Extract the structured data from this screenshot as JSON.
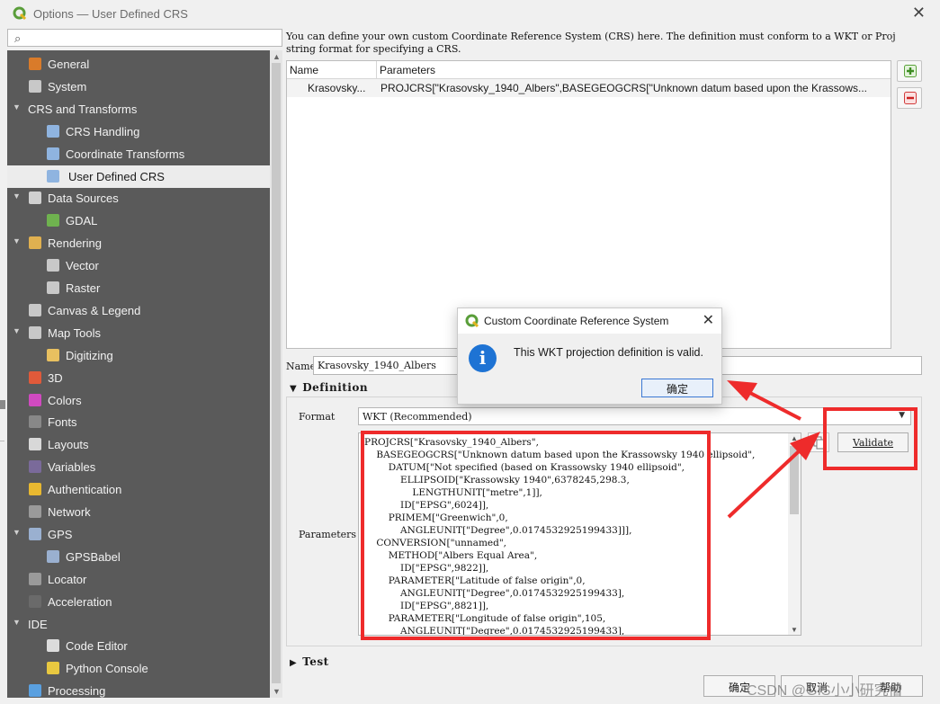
{
  "window": {
    "title": "Options — User Defined CRS",
    "close_glyph": "✕"
  },
  "search": {
    "placeholder": "",
    "icon": "search-icon"
  },
  "sidebar": {
    "items": [
      {
        "label": "General",
        "level": 0,
        "expander": "",
        "icon": "wrench-icon",
        "color": "#d97b2a"
      },
      {
        "label": "System",
        "level": 0,
        "expander": "",
        "icon": "gear-icon",
        "color": "#c8c8c8"
      },
      {
        "label": "CRS and Transforms",
        "level": 0,
        "expander": "▼",
        "icon": "",
        "color": ""
      },
      {
        "label": "CRS Handling",
        "level": 1,
        "expander": "",
        "icon": "globe-icon",
        "color": "#8fb4e0"
      },
      {
        "label": "Coordinate Transforms",
        "level": 1,
        "expander": "",
        "icon": "globe-icon",
        "color": "#8fb4e0"
      },
      {
        "label": "User Defined CRS",
        "level": 1,
        "expander": "",
        "icon": "user-globe-icon",
        "color": "#8fb4e0",
        "selected": true
      },
      {
        "label": "Data Sources",
        "level": 0,
        "expander": "▼",
        "icon": "table-icon",
        "color": "#d0d0d0"
      },
      {
        "label": "GDAL",
        "level": 1,
        "expander": "",
        "icon": "gdal-globe-icon",
        "color": "#6fb24f"
      },
      {
        "label": "Rendering",
        "level": 0,
        "expander": "▼",
        "icon": "brush-icon",
        "color": "#e0b050"
      },
      {
        "label": "Vector",
        "level": 1,
        "expander": "",
        "icon": "vector-icon",
        "color": "#c8c8c8"
      },
      {
        "label": "Raster",
        "level": 1,
        "expander": "",
        "icon": "raster-icon",
        "color": "#c8c8c8"
      },
      {
        "label": "Canvas & Legend",
        "level": 0,
        "expander": "",
        "icon": "canvas-icon",
        "color": "#c8c8c8"
      },
      {
        "label": "Map Tools",
        "level": 0,
        "expander": "▼",
        "icon": "map-tools-icon",
        "color": "#c8c8c8"
      },
      {
        "label": "Digitizing",
        "level": 1,
        "expander": "",
        "icon": "digitizing-icon",
        "color": "#e8c060"
      },
      {
        "label": "3D",
        "level": 0,
        "expander": "",
        "icon": "cube-icon",
        "color": "#e05a3a"
      },
      {
        "label": "Colors",
        "level": 0,
        "expander": "",
        "icon": "palette-icon",
        "color": "#d04ac0"
      },
      {
        "label": "Fonts",
        "level": 0,
        "expander": "",
        "icon": "font-icon",
        "color": "#888888"
      },
      {
        "label": "Layouts",
        "level": 0,
        "expander": "",
        "icon": "layout-icon",
        "color": "#d8d8d8"
      },
      {
        "label": "Variables",
        "level": 0,
        "expander": "",
        "icon": "variables-icon",
        "color": "#7a6a9a"
      },
      {
        "label": "Authentication",
        "level": 0,
        "expander": "",
        "icon": "lock-icon",
        "color": "#e8b830"
      },
      {
        "label": "Network",
        "level": 0,
        "expander": "",
        "icon": "network-icon",
        "color": "#9a9a9a"
      },
      {
        "label": "GPS",
        "level": 0,
        "expander": "▼",
        "icon": "gps-icon",
        "color": "#9ab0d0"
      },
      {
        "label": "GPSBabel",
        "level": 1,
        "expander": "",
        "icon": "gpsbabel-icon",
        "color": "#9ab0d0"
      },
      {
        "label": "Locator",
        "level": 0,
        "expander": "",
        "icon": "locator-search-icon",
        "color": "#9a9a9a"
      },
      {
        "label": "Acceleration",
        "level": 0,
        "expander": "",
        "icon": "acceleration-icon",
        "color": "#6a6a6a"
      },
      {
        "label": "IDE",
        "level": 0,
        "expander": "▼",
        "icon": "",
        "color": ""
      },
      {
        "label": "Code Editor",
        "level": 1,
        "expander": "",
        "icon": "code-editor-icon",
        "color": "#dcdcdc"
      },
      {
        "label": "Python Console",
        "level": 1,
        "expander": "",
        "icon": "python-icon",
        "color": "#e8c840"
      },
      {
        "label": "Processing",
        "level": 0,
        "expander": "",
        "icon": "processing-gear-icon",
        "color": "#5aa0e0"
      }
    ]
  },
  "description": "You can define your own custom Coordinate Reference System (CRS) here. The definition must conform to a WKT or Proj string format for specifying a CRS.",
  "crs_table": {
    "columns": [
      "Name",
      "Parameters"
    ],
    "rows": [
      {
        "name": "Krasovsky...",
        "parameters": "PROJCRS[\"Krasovsky_1940_Albers\",BASEGEOGCRS[\"Unknown datum based upon the Krassows..."
      }
    ]
  },
  "buttons": {
    "add": "add-crs-icon",
    "remove": "remove-crs-icon",
    "validate": "Validate",
    "ok": "确定",
    "cancel": "取消",
    "help": "帮助"
  },
  "name_field": {
    "label": "Name",
    "value": "Krasovsky_1940_Albers"
  },
  "definition": {
    "header": "Definition",
    "format_label": "Format",
    "format_value": "WKT (Recommended)",
    "params_label": "Parameters",
    "wkt_text": "PROJCRS[\"Krasovsky_1940_Albers\",\n    BASEGEOGCRS[\"Unknown datum based upon the Krassowsky 1940 ellipsoid\",\n        DATUM[\"Not specified (based on Krassowsky 1940 ellipsoid\",\n            ELLIPSOID[\"Krassowsky 1940\",6378245,298.3,\n                LENGTHUNIT[\"metre\",1]],\n            ID[\"EPSG\",6024]],\n        PRIMEM[\"Greenwich\",0,\n            ANGLEUNIT[\"Degree\",0.0174532925199433]]],\n    CONVERSION[\"unnamed\",\n        METHOD[\"Albers Equal Area\",\n            ID[\"EPSG\",9822]],\n        PARAMETER[\"Latitude of false origin\",0,\n            ANGLEUNIT[\"Degree\",0.0174532925199433],\n            ID[\"EPSG\",8821]],\n        PARAMETER[\"Longitude of false origin\",105,\n            ANGLEUNIT[\"Degree\",0.0174532925199433],"
  },
  "test_header": "Test",
  "dialog": {
    "title": "Custom Coordinate Reference System",
    "message": "This WKT projection definition is valid.",
    "ok": "确定",
    "close_glyph": "✕",
    "info_glyph": "i"
  },
  "watermark": "CSDN @GIS小小研究僧",
  "colors": {
    "annotation_red": "#ee2b2b",
    "sidebar_bg": "#5a5a5a",
    "info_blue": "#1e73d4",
    "qgis_green": "#5a9e3a"
  }
}
